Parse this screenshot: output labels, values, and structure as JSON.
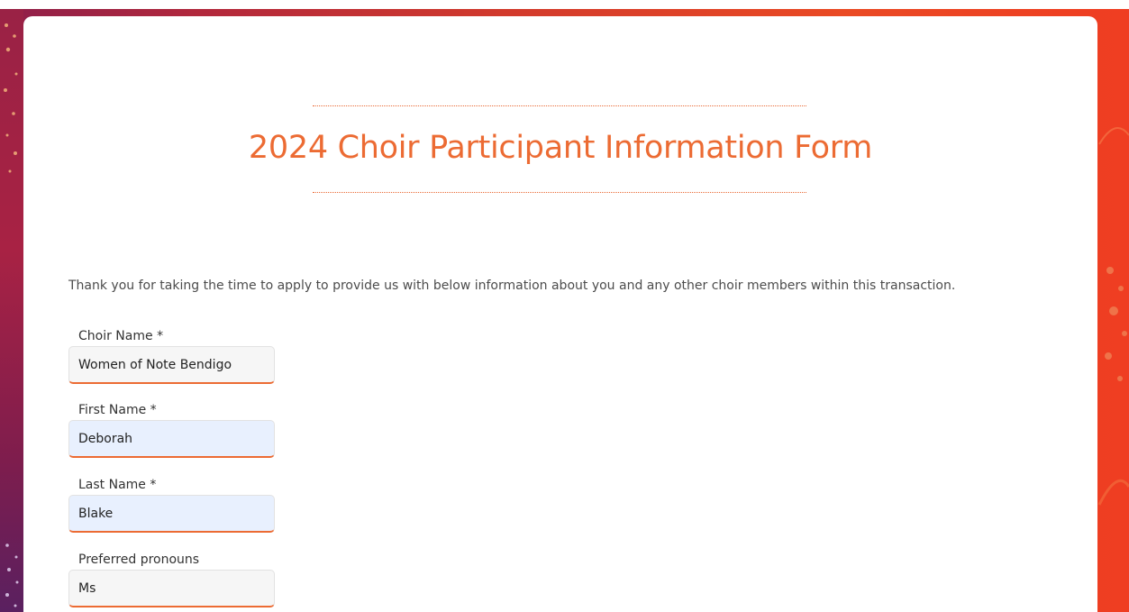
{
  "form": {
    "title": "2024 Choir Participant Information Form",
    "intro": "Thank you for taking the time to apply to provide us with below information about you and any other choir members within this transaction.",
    "fields": [
      {
        "label": "Choir Name *",
        "value": "Women of Note Bendigo"
      },
      {
        "label": "First Name *",
        "value": "Deborah"
      },
      {
        "label": "Last Name *",
        "value": "Blake"
      },
      {
        "label": "Preferred pronouns",
        "value": "Ms"
      }
    ]
  },
  "colors": {
    "accent": "#ec6b33",
    "autofill_bg": "#e8f0fe",
    "input_bg": "#f6f6f6"
  }
}
